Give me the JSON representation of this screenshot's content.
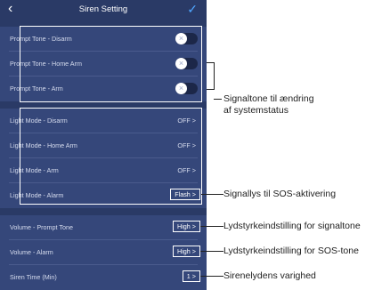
{
  "header": {
    "title": "Siren Setting",
    "back_icon": "back-chevron-icon",
    "confirm_icon": "checkmark-icon"
  },
  "prompt_tone": [
    {
      "label": "Prompt Tone - Disarm",
      "state": "off"
    },
    {
      "label": "Prompt Tone - Home Arm",
      "state": "off"
    },
    {
      "label": "Prompt Tone - Arm",
      "state": "off"
    }
  ],
  "light_mode": [
    {
      "label": "Light Mode - Disarm",
      "value": "OFF >"
    },
    {
      "label": "Light Mode - Home Arm",
      "value": "OFF >"
    },
    {
      "label": "Light Mode - Arm",
      "value": "OFF >"
    },
    {
      "label": "Light Mode - Alarm",
      "value": "Flash >"
    }
  ],
  "volume": [
    {
      "label": "Volume - Prompt Tone",
      "value": "High >"
    },
    {
      "label": "Volume - Alarm",
      "value": "High >"
    },
    {
      "label": "Siren Time (Min)",
      "value": "1 >"
    }
  ],
  "annotations": {
    "prompt_tone_line1": "Signaltone til ændring",
    "prompt_tone_line2": "af systemstatus",
    "light_alarm": "Signallys til SOS-aktivering",
    "volume_prompt": "Lydstyrkeindstilling for signaltone",
    "volume_alarm": "Lydstyrkeindstilling for SOS-tone",
    "siren_time": "Sirenelydens varighed"
  },
  "colors": {
    "background": "#2a3a66",
    "section": "#35477a",
    "accent": "#4fa6ff"
  }
}
